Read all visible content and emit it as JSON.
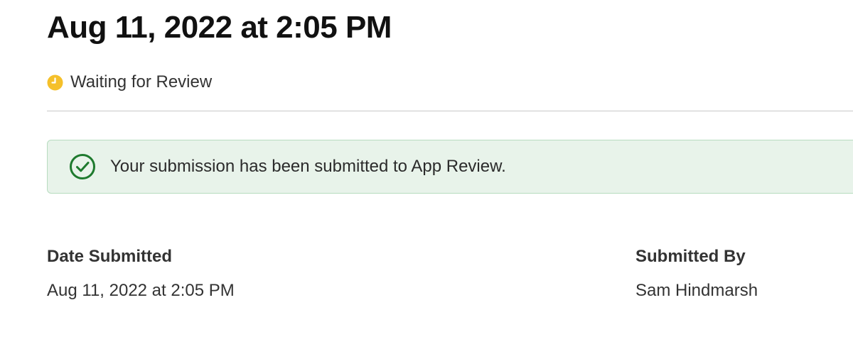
{
  "header": {
    "title": "Aug 11, 2022 at 2:05 PM"
  },
  "status": {
    "icon": "clock-icon",
    "icon_color": "#f5c02a",
    "text": "Waiting for Review"
  },
  "banner": {
    "icon": "check-circle-icon",
    "icon_color": "#1e7a2e",
    "background": "#e8f3ea",
    "text": "Your submission has been submitted to App Review."
  },
  "details": {
    "date_submitted": {
      "label": "Date Submitted",
      "value": "Aug 11, 2022 at 2:05 PM"
    },
    "submitted_by": {
      "label": "Submitted By",
      "value": "Sam Hindmarsh"
    }
  }
}
